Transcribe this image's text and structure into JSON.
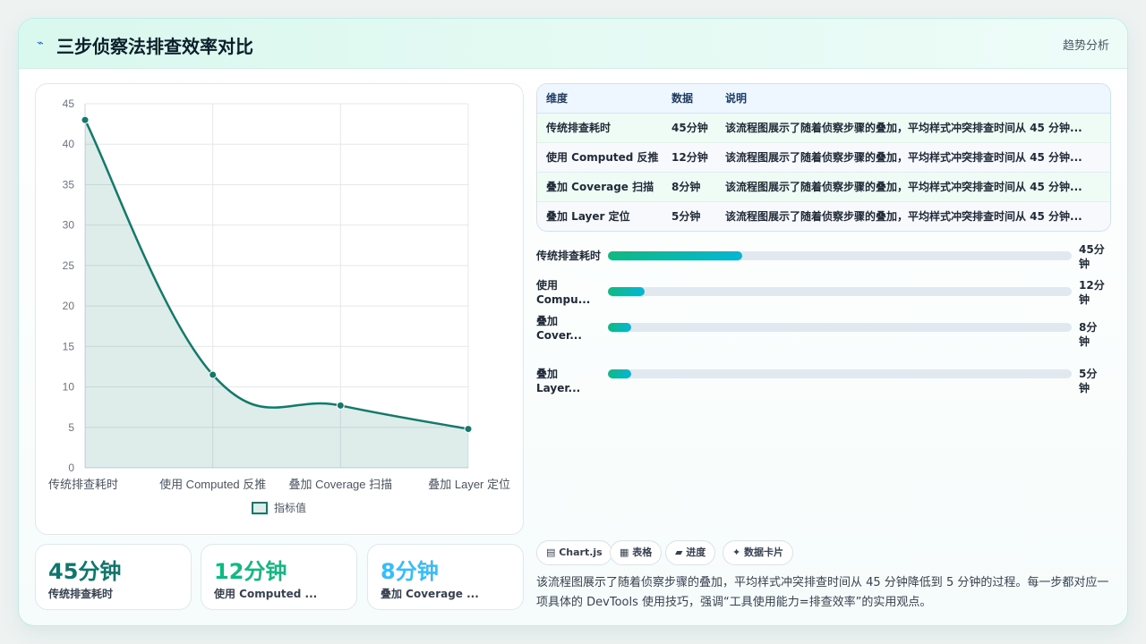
{
  "header": {
    "title": "三步侦察法排查效率对比",
    "tag": "趋势分析"
  },
  "chart_data": {
    "type": "line",
    "categories": [
      "传统排查耗时",
      "使用 Computed 反推",
      "叠加 Coverage 扫描",
      "叠加 Layer 定位"
    ],
    "series": [
      {
        "name": "指标值",
        "values": [
          43,
          11.5,
          7.7,
          4.8
        ],
        "color": "#137a6b"
      }
    ],
    "yticks": [
      "0",
      "5",
      "10",
      "15",
      "20",
      "25",
      "30",
      "35",
      "40",
      "45"
    ],
    "ylim": [
      0,
      45
    ],
    "grid": true,
    "legend": "bottom"
  },
  "table": {
    "headers": [
      "维度",
      "数据",
      "说明"
    ],
    "rows": [
      [
        "传统排查耗时",
        "45分钟",
        "该流程图展示了随着侦察步骤的叠加，平均样式冲突排查时间从 45 分钟..."
      ],
      [
        "使用 Computed 反推",
        "12分钟",
        "该流程图展示了随着侦察步骤的叠加，平均样式冲突排查时间从 45 分钟..."
      ],
      [
        "叠加 Coverage 扫描",
        "8分钟",
        "该流程图展示了随着侦察步骤的叠加，平均样式冲突排查时间从 45 分钟..."
      ],
      [
        "叠加 Layer 定位",
        "5分钟",
        "该流程图展示了随着侦察步骤的叠加，平均样式冲突排查时间从 45 分钟..."
      ]
    ]
  },
  "progress": [
    {
      "label": "传统排查耗时",
      "value_text": "45分钟",
      "fraction": 0.29
    },
    {
      "label": "使用 Compu...",
      "value_text": "12分钟",
      "fraction": 0.08
    },
    {
      "label": "叠加 Cover...",
      "value_text": "8分钟",
      "fraction": 0.05
    },
    {
      "label": "叠加 Layer...",
      "value_text": "5分钟",
      "fraction": 0.05
    }
  ],
  "stats": [
    {
      "value": "45分钟",
      "label": "传统排查耗时",
      "color": "#0f766e"
    },
    {
      "value": "12分钟",
      "label": "使用 Computed ...",
      "color": "#10b981"
    },
    {
      "value": "8分钟",
      "label": "叠加 Coverage ...",
      "color": "#38bdf8"
    }
  ],
  "chips": [
    "▤ Chart.js",
    "▦ 表格",
    "▰ 进度",
    "✦ 数据卡片"
  ],
  "summary": "该流程图展示了随着侦察步骤的叠加，平均样式冲突排查时间从 45 分钟降低到 5 分钟的过程。每一步都对应一项具体的 DevTools 使用技巧，强调“工具使用能力=排查效率”的实用观点。"
}
